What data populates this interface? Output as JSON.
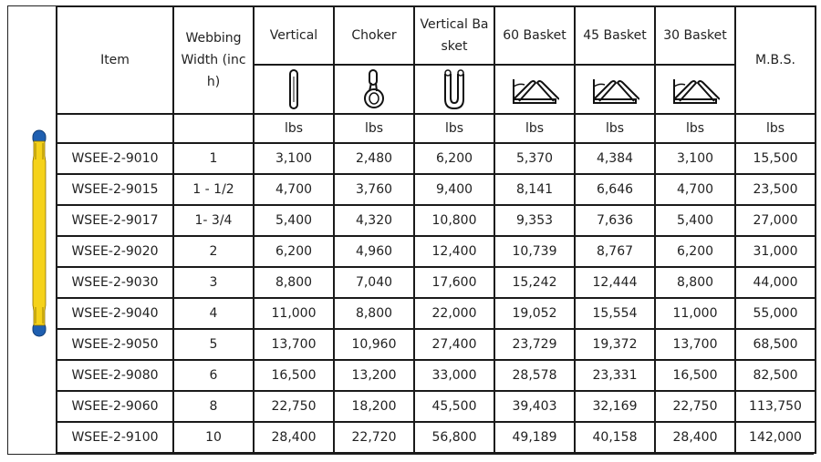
{
  "table": {
    "headers": {
      "item": "Item",
      "webbing_width": "Webbing Width (inch)",
      "webbing_width_lines": [
        "Webbing",
        "Width (inc",
        "h)"
      ],
      "vertical": "Vertical",
      "choker": "Choker",
      "vertical_basket": "Vertical Basket",
      "vertical_basket_lines": [
        "Vertical Ba",
        "sket"
      ],
      "basket_60": "60 Basket",
      "basket_45": "45 Basket",
      "basket_30": "30 Basket",
      "mbs": "M.B.S."
    },
    "icons": {
      "sling": "yellow-web-sling-icon",
      "vertical": "vertical-hitch-icon",
      "choker": "choker-hitch-icon",
      "vertical_basket": "vertical-basket-hitch-icon",
      "basket_60": "basket-60-hitch-icon",
      "basket_45": "basket-45-hitch-icon",
      "basket_30": "basket-30-hitch-icon"
    },
    "unit": "lbs",
    "colors": {
      "sling_body": "#f5d21a",
      "sling_end": "#1f5fb0",
      "border": "#1a1a1a"
    },
    "rows": [
      [
        "WSEE-2-9010",
        "1",
        "3,100",
        "2,480",
        "6,200",
        "5,370",
        "4,384",
        "3,100",
        "15,500"
      ],
      [
        "WSEE-2-9015",
        "1 - 1/2",
        "4,700",
        "3,760",
        "9,400",
        "8,141",
        "6,646",
        "4,700",
        "23,500"
      ],
      [
        "WSEE-2-9017",
        "1- 3/4",
        "5,400",
        "4,320",
        "10,800",
        "9,353",
        "7,636",
        "5,400",
        "27,000"
      ],
      [
        "WSEE-2-9020",
        "2",
        "6,200",
        "4,960",
        "12,400",
        "10,739",
        "8,767",
        "6,200",
        "31,000"
      ],
      [
        "WSEE-2-9030",
        "3",
        "8,800",
        "7,040",
        "17,600",
        "15,242",
        "12,444",
        "8,800",
        "44,000"
      ],
      [
        "WSEE-2-9040",
        "4",
        "11,000",
        "8,800",
        "22,000",
        "19,052",
        "15,554",
        "11,000",
        "55,000"
      ],
      [
        "WSEE-2-9050",
        "5",
        "13,700",
        "10,960",
        "27,400",
        "23,729",
        "19,372",
        "13,700",
        "68,500"
      ],
      [
        "WSEE-2-9080",
        "6",
        "16,500",
        "13,200",
        "33,000",
        "28,578",
        "23,331",
        "16,500",
        "82,500"
      ],
      [
        "WSEE-2-9060",
        "8",
        "22,750",
        "18,200",
        "45,500",
        "39,403",
        "32,169",
        "22,750",
        "113,750"
      ],
      [
        "WSEE-2-9100",
        "10",
        "28,400",
        "22,720",
        "56,800",
        "49,189",
        "40,158",
        "28,400",
        "142,000"
      ]
    ]
  }
}
